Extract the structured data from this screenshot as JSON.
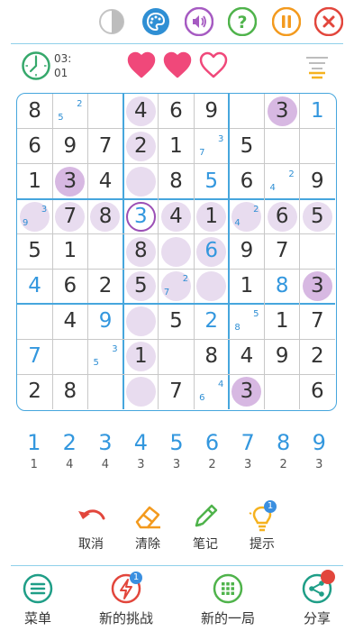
{
  "top_bar": {
    "icons": [
      "contrast-icon",
      "palette-icon",
      "sound-icon",
      "help-icon",
      "pause-icon",
      "close-icon"
    ]
  },
  "status": {
    "timer_line1": "03:",
    "timer_line2": "01",
    "lives_total": 3,
    "lives_remaining": 2
  },
  "colors": {
    "accent": "#3397de",
    "given_digit": "#333333",
    "entered_digit": "#3397de",
    "highlight": "#e8dcef",
    "highlight_strong": "#d7b8e2",
    "selected_ring": "#9b4fb5",
    "heart": "#f0487a"
  },
  "board": {
    "rows": [
      [
        {
          "v": "8",
          "t": "given"
        },
        {
          "n": [
            "2",
            "5"
          ]
        },
        {},
        {
          "v": "4",
          "t": "given",
          "hl": "l"
        },
        {
          "v": "6",
          "t": "given"
        },
        {
          "v": "9",
          "t": "given"
        },
        {},
        {
          "v": "3",
          "t": "given",
          "hl": "d"
        },
        {
          "v": "1",
          "t": "entered"
        }
      ],
      [
        {
          "v": "6",
          "t": "given"
        },
        {
          "v": "9",
          "t": "given"
        },
        {
          "v": "7",
          "t": "given"
        },
        {
          "v": "2",
          "t": "given",
          "hl": "l"
        },
        {
          "v": "1",
          "t": "given"
        },
        {
          "n": [
            "3",
            "7"
          ]
        },
        {
          "v": "5",
          "t": "given"
        },
        {},
        {}
      ],
      [
        {
          "v": "1",
          "t": "given"
        },
        {
          "v": "3",
          "t": "given",
          "hl": "d"
        },
        {
          "v": "4",
          "t": "given"
        },
        {
          "hl": "l"
        },
        {
          "v": "8",
          "t": "given"
        },
        {
          "v": "5",
          "t": "entered"
        },
        {
          "v": "6",
          "t": "given"
        },
        {
          "n": [
            "2",
            "4"
          ]
        },
        {
          "v": "9",
          "t": "given"
        }
      ],
      [
        {
          "n": [
            "3",
            "9"
          ],
          "hl": "l"
        },
        {
          "v": "7",
          "t": "given",
          "hl": "l"
        },
        {
          "v": "8",
          "t": "given",
          "hl": "l"
        },
        {
          "v": "3",
          "t": "entered",
          "sel": true
        },
        {
          "v": "4",
          "t": "given",
          "hl": "l"
        },
        {
          "v": "1",
          "t": "given",
          "hl": "l"
        },
        {
          "n": [
            "2",
            "4"
          ],
          "hl": "l"
        },
        {
          "v": "6",
          "t": "given",
          "hl": "l"
        },
        {
          "v": "5",
          "t": "given",
          "hl": "l"
        }
      ],
      [
        {
          "v": "5",
          "t": "given"
        },
        {
          "v": "1",
          "t": "given"
        },
        {},
        {
          "v": "8",
          "t": "given",
          "hl": "l"
        },
        {
          "hl": "l"
        },
        {
          "v": "6",
          "t": "entered",
          "hl": "l"
        },
        {
          "v": "9",
          "t": "given"
        },
        {
          "v": "7",
          "t": "given"
        },
        {}
      ],
      [
        {
          "v": "4",
          "t": "entered"
        },
        {
          "v": "6",
          "t": "given"
        },
        {
          "v": "2",
          "t": "given"
        },
        {
          "v": "5",
          "t": "given",
          "hl": "l"
        },
        {
          "n": [
            "2",
            "7"
          ],
          "hl": "l"
        },
        {
          "hl": "l"
        },
        {
          "v": "1",
          "t": "given"
        },
        {
          "v": "8",
          "t": "entered"
        },
        {
          "v": "3",
          "t": "given",
          "hl": "d"
        }
      ],
      [
        {},
        {
          "v": "4",
          "t": "given"
        },
        {
          "v": "9",
          "t": "entered"
        },
        {
          "hl": "l"
        },
        {
          "v": "5",
          "t": "given"
        },
        {
          "v": "2",
          "t": "entered"
        },
        {
          "n": [
            "5",
            "8"
          ]
        },
        {
          "v": "1",
          "t": "given"
        },
        {
          "v": "7",
          "t": "given"
        }
      ],
      [
        {
          "v": "7",
          "t": "entered"
        },
        {},
        {
          "n": [
            "3",
            "5"
          ]
        },
        {
          "v": "1",
          "t": "given",
          "hl": "l"
        },
        {},
        {
          "v": "8",
          "t": "given"
        },
        {
          "v": "4",
          "t": "given"
        },
        {
          "v": "9",
          "t": "given"
        },
        {
          "v": "2",
          "t": "given"
        }
      ],
      [
        {
          "v": "2",
          "t": "given"
        },
        {
          "v": "8",
          "t": "given"
        },
        {},
        {
          "hl": "l"
        },
        {
          "v": "7",
          "t": "given"
        },
        {
          "n": [
            "4",
            "6"
          ]
        },
        {
          "v": "3",
          "t": "given",
          "hl": "d"
        },
        {},
        {
          "v": "6",
          "t": "given"
        }
      ]
    ]
  },
  "numpad": [
    {
      "digit": "1",
      "remaining": "1"
    },
    {
      "digit": "2",
      "remaining": "4"
    },
    {
      "digit": "3",
      "remaining": "4"
    },
    {
      "digit": "4",
      "remaining": "3"
    },
    {
      "digit": "5",
      "remaining": "3"
    },
    {
      "digit": "6",
      "remaining": "2"
    },
    {
      "digit": "7",
      "remaining": "3"
    },
    {
      "digit": "8",
      "remaining": "2"
    },
    {
      "digit": "9",
      "remaining": "3"
    }
  ],
  "tools": {
    "undo_label": "取消",
    "erase_label": "清除",
    "notes_label": "笔记",
    "hint_label": "提示",
    "hint_badge": "1"
  },
  "bottom_nav": {
    "menu_label": "菜单",
    "challenge_label": "新的挑战",
    "challenge_badge": "1",
    "new_game_label": "新的一局",
    "share_label": "分享"
  }
}
